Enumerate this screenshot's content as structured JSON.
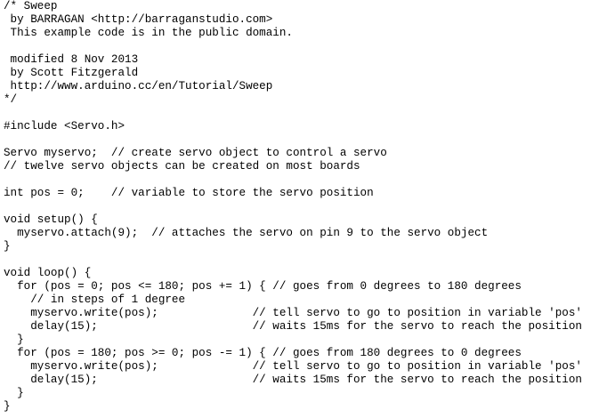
{
  "editor": {
    "lines": [
      "/* Sweep",
      " by BARRAGAN <http://barraganstudio.com>",
      " This example code is in the public domain.",
      "",
      " modified 8 Nov 2013",
      " by Scott Fitzgerald",
      " http://www.arduino.cc/en/Tutorial/Sweep",
      "*/",
      "",
      "#include <Servo.h>",
      "",
      "Servo myservo;  // create servo object to control a servo",
      "// twelve servo objects can be created on most boards",
      "",
      "int pos = 0;    // variable to store the servo position",
      "",
      "void setup() {",
      "  myservo.attach(9);  // attaches the servo on pin 9 to the servo object",
      "}",
      "",
      "void loop() {",
      "  for (pos = 0; pos <= 180; pos += 1) { // goes from 0 degrees to 180 degrees",
      "    // in steps of 1 degree",
      "    myservo.write(pos);              // tell servo to go to position in variable 'pos'",
      "    delay(15);                       // waits 15ms for the servo to reach the position",
      "  }",
      "  for (pos = 180; pos >= 0; pos -= 1) { // goes from 180 degrees to 0 degrees",
      "    myservo.write(pos);              // tell servo to go to position in variable 'pos'",
      "    delay(15);                       // waits 15ms for the servo to reach the position",
      "  }",
      "}"
    ]
  }
}
